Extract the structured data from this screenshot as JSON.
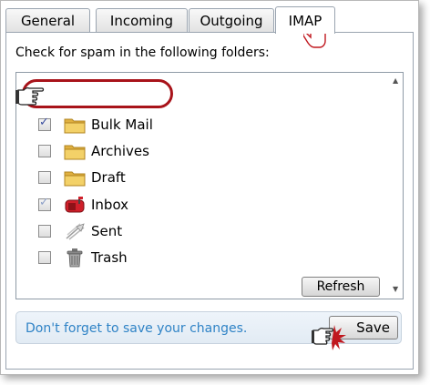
{
  "tabs": [
    {
      "label": "General",
      "active": false
    },
    {
      "label": "Incoming",
      "active": false
    },
    {
      "label": "Outgoing",
      "active": false
    },
    {
      "label": "IMAP",
      "active": true
    }
  ],
  "instruction": "Check for spam in the following folders:",
  "folders": [
    {
      "label": "Bulk Mail",
      "checked": true,
      "icon": "folder-icon"
    },
    {
      "label": "Archives",
      "checked": false,
      "icon": "folder-icon"
    },
    {
      "label": "Draft",
      "checked": false,
      "icon": "folder-icon"
    },
    {
      "label": "Inbox",
      "checked": true,
      "icon": "mailbox-icon"
    },
    {
      "label": "Sent",
      "checked": false,
      "icon": "sent-icon"
    },
    {
      "label": "Trash",
      "checked": false,
      "icon": "trash-icon"
    }
  ],
  "refresh_label": "Refresh",
  "reminder": "Don't forget to save your changes.",
  "save_label": "Save",
  "colors": {
    "highlight": "#a8131a",
    "reminder_text": "#2f83c6",
    "folder": "#f0c85a",
    "mailbox": "#d01f2a"
  }
}
